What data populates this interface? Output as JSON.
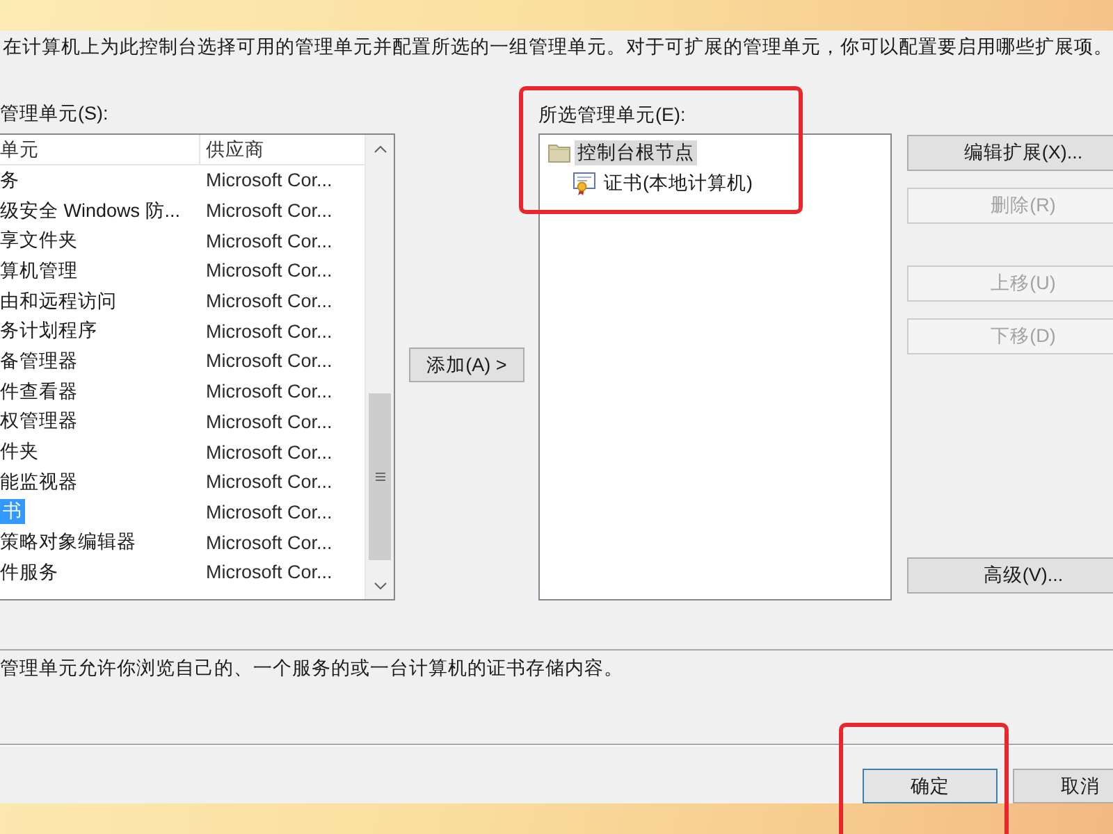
{
  "instruction": "在计算机上为此控制台选择可用的管理单元并配置所选的一组管理单元。对于可扩展的管理单元，你可以配置要启用哪些扩展项。",
  "available_snapins": {
    "label": "管理单元(S):",
    "columns": [
      "单元",
      "供应商"
    ],
    "rows": [
      {
        "name": "务",
        "vendor": "Microsoft Cor...",
        "selected": false
      },
      {
        "name": "级安全 Windows 防...",
        "vendor": "Microsoft Cor...",
        "selected": false
      },
      {
        "name": "享文件夹",
        "vendor": "Microsoft Cor...",
        "selected": false
      },
      {
        "name": "算机管理",
        "vendor": "Microsoft Cor...",
        "selected": false
      },
      {
        "name": "由和远程访问",
        "vendor": "Microsoft Cor...",
        "selected": false
      },
      {
        "name": "务计划程序",
        "vendor": "Microsoft Cor...",
        "selected": false
      },
      {
        "name": "备管理器",
        "vendor": "Microsoft Cor...",
        "selected": false
      },
      {
        "name": "件查看器",
        "vendor": "Microsoft Cor...",
        "selected": false
      },
      {
        "name": "权管理器",
        "vendor": "Microsoft Cor...",
        "selected": false
      },
      {
        "name": "件夹",
        "vendor": "Microsoft Cor...",
        "selected": false
      },
      {
        "name": "能监视器",
        "vendor": "Microsoft Cor...",
        "selected": false
      },
      {
        "name": "书",
        "vendor": "Microsoft Cor...",
        "selected": true
      },
      {
        "name": "策略对象编辑器",
        "vendor": "Microsoft Cor...",
        "selected": false
      },
      {
        "name": "件服务",
        "vendor": "Microsoft Cor...",
        "selected": false
      }
    ]
  },
  "add_button": {
    "label": "添加(A) >"
  },
  "selected_snapins": {
    "label": "所选管理单元(E):",
    "highlighted": true,
    "items": [
      {
        "label": "控制台根节点",
        "kind": "folder",
        "selected": true,
        "children": [
          {
            "label": "证书(本地计算机)",
            "kind": "certificate",
            "selected": false
          }
        ]
      }
    ]
  },
  "button_groups": [
    {
      "buttons": [
        {
          "label": "编辑扩展(X)...",
          "disabled": false
        },
        {
          "label": "删除(R)",
          "disabled": true
        }
      ]
    },
    {
      "buttons": [
        {
          "label": "上移(U)",
          "disabled": true
        },
        {
          "label": "下移(D)",
          "disabled": true
        }
      ]
    },
    {
      "buttons": [
        {
          "label": "高级(V)...",
          "disabled": false
        }
      ]
    }
  ],
  "description": "管理单元允许你浏览自己的、一个服务的或一台计算机的证书存储内容。",
  "footer_buttons": [
    {
      "label": "确定",
      "default": true,
      "highlighted": true
    },
    {
      "label": "取消",
      "default": false,
      "highlighted": false
    }
  ]
}
